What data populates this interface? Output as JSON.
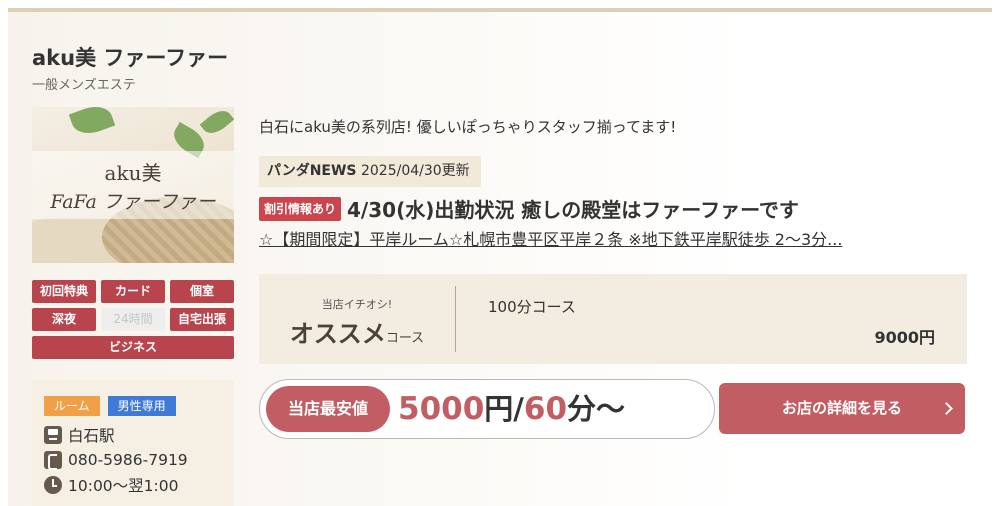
{
  "shop": {
    "name": "aku美 ファーファー",
    "genre": "一般メンズエステ",
    "photo_logo_top": "aku美",
    "photo_logo_bottom": "FaFa ファーファー"
  },
  "badges": [
    {
      "label": "初回特典",
      "active": true
    },
    {
      "label": "カード",
      "active": true
    },
    {
      "label": "個室",
      "active": true
    },
    {
      "label": "深夜",
      "active": true
    },
    {
      "label": "24時間",
      "active": false
    },
    {
      "label": "自宅出張",
      "active": true
    },
    {
      "label": "ビジネス",
      "active": true
    }
  ],
  "info": {
    "tag_room": "ルーム",
    "tag_male": "男性専用",
    "station": "白石駅",
    "phone": "080-5986-7919",
    "hours": "10:00～翌1:00"
  },
  "catch": "白石にaku美の系列店! 優しいぽっちゃりスタッフ揃ってます!",
  "news": {
    "label": "パンダNEWS",
    "date": "2025/04/30更新",
    "discount_badge": "割引情報あり",
    "title": "4/30(水)出勤状況 癒しの殿堂はファーファーです",
    "subtitle": "☆【期間限定】平岸ルーム☆札幌市豊平区平岸２条 ※地下鉄平岸駅徒歩 2～3分..."
  },
  "course": {
    "pick_label": "当店イチオシ!",
    "rec_main": "オススメ",
    "rec_suffix": "コース",
    "name": "100分コース",
    "price": "9000円"
  },
  "lowest": {
    "label": "当店最安値",
    "price": "5000",
    "price_unit": "円/",
    "minutes": "60",
    "minutes_unit": "分～"
  },
  "detail_button": "お店の詳細を見る",
  "colors": {
    "accent_red": "#c25e63",
    "badge_red": "#b8454d",
    "tag_orange": "#f0a047",
    "tag_blue": "#3f7bd6"
  }
}
